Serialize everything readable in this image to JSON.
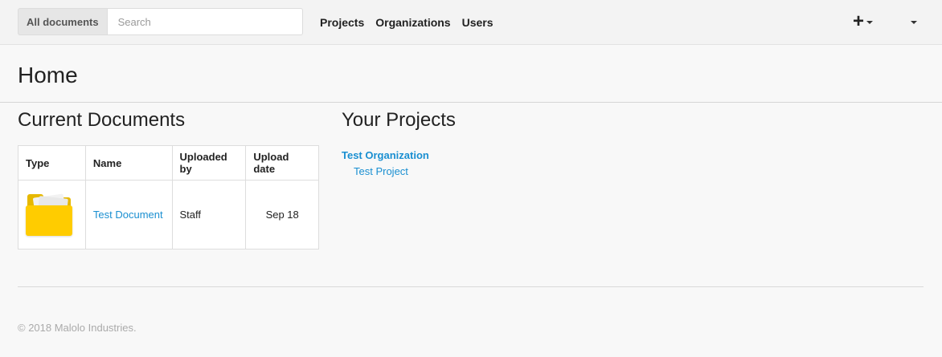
{
  "navbar": {
    "search_scope_label": "All documents",
    "search_placeholder": "Search",
    "links": [
      "Projects",
      "Organizations",
      "Users"
    ],
    "add_icon": "plus-icon",
    "menu_icon": "caret-down-icon"
  },
  "page": {
    "title": "Home"
  },
  "documents": {
    "heading": "Current Documents",
    "columns": [
      "Type",
      "Name",
      "Uploaded by",
      "Upload date"
    ],
    "rows": [
      {
        "type_icon": "folder-icon",
        "name": "Test Document",
        "uploaded_by": "Staff",
        "upload_date": "Sep 18"
      }
    ]
  },
  "projects": {
    "heading": "Your Projects",
    "organization": "Test Organization",
    "project": "Test Project"
  },
  "footer": {
    "copyright": "© 2018 Malolo Industries."
  },
  "colors": {
    "link": "#1a8fd1",
    "folder": "#ffcc00"
  }
}
